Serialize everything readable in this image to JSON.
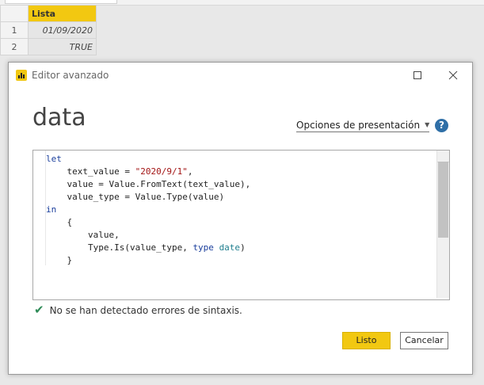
{
  "sheet": {
    "column_header": "Lista",
    "rows": [
      {
        "num": "1",
        "value": "01/09/2020"
      },
      {
        "num": "2",
        "value": "TRUE"
      }
    ]
  },
  "dialog": {
    "title": "Editor avanzado",
    "icons": {
      "app": "power-bi-logo-icon",
      "minimize": "minimize-icon",
      "maximize": "maximize-icon",
      "close": "close-icon",
      "help": "help-icon",
      "status": "checkmark-icon"
    },
    "query_name": "data",
    "view_options_label": "Opciones de presentación",
    "help_label": "?",
    "code": {
      "let": "let",
      "text_value_pre": "text_value = ",
      "text_value_str": "\"2020/9/1\"",
      "text_value_post": ",",
      "value_line": "value = Value.FromText(text_value),",
      "value_type_line": "value_type = Value.Type(value)",
      "in": "in",
      "open_brace": "{",
      "value_item": "value,",
      "type_is_pre": "Type.Is(value_type, ",
      "type_kw": "type",
      "type_date": "date",
      "type_is_post": ")",
      "close_brace": "}"
    },
    "status_message": "No se han detectado errores de sintaxis.",
    "ok_label": "Listo",
    "cancel_label": "Cancelar"
  },
  "colors": {
    "accent": "#f2c811",
    "check": "#2e8b57",
    "help": "#2f6fa7",
    "keyword": "#1a3e9c",
    "string": "#a31515",
    "type": "#1f7e8e"
  }
}
